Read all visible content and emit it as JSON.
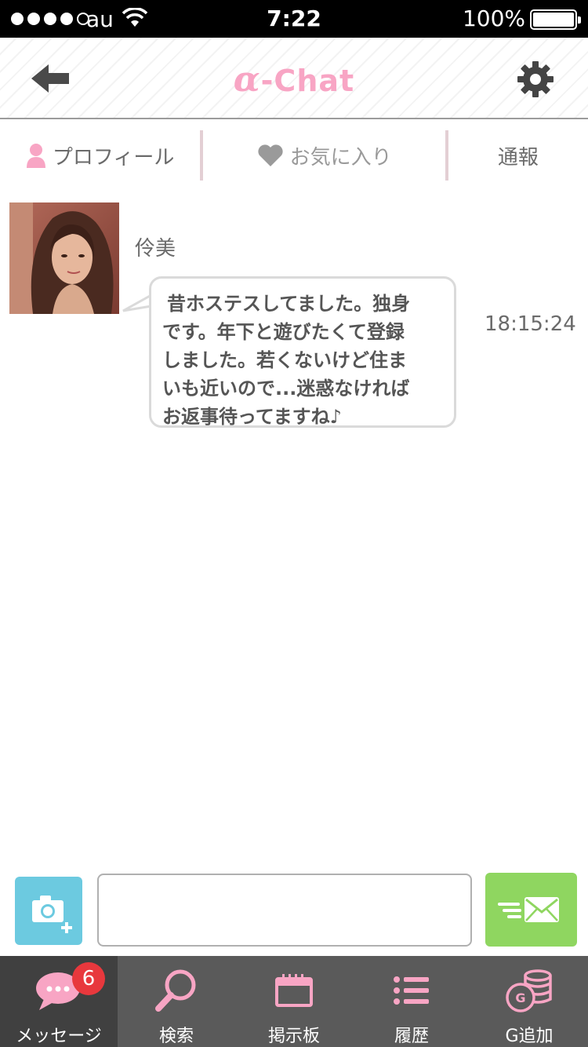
{
  "status_bar": {
    "carrier": "au",
    "time": "7:22",
    "battery_percent": "100%",
    "signal_bars": 4
  },
  "header": {
    "title_alpha": "α",
    "title_rest": "-Chat",
    "back_icon": "arrow-left-icon",
    "settings_icon": "gear-icon"
  },
  "tabs": [
    {
      "label": "プロフィール",
      "icon": "person-icon"
    },
    {
      "label": "お気に入り",
      "icon": "heart-icon"
    },
    {
      "label": "通報"
    }
  ],
  "message": {
    "sender": "伶美",
    "text_lines": [
      "昔ホステスしてました。独身",
      "です。年下と遊びたくて登録",
      "しました。若くないけど住ま",
      "いも近いので...迷惑なければ",
      "お返事待ってますね♪"
    ],
    "time": "18:15:24"
  },
  "input": {
    "value": "",
    "camera_icon": "camera-plus-icon",
    "send_icon": "envelope-send-icon"
  },
  "nav": [
    {
      "label": "メッセージ",
      "icon": "chat-bubble-icon",
      "badge": "6",
      "active": true
    },
    {
      "label": "検索",
      "icon": "magnifier-icon"
    },
    {
      "label": "掲示板",
      "icon": "board-icon"
    },
    {
      "label": "履歴",
      "icon": "list-icon"
    },
    {
      "label": "G追加",
      "icon": "coins-icon"
    }
  ],
  "colors": {
    "accent_pink": "#f8a5c4",
    "send_green": "#8fd660",
    "camera_blue": "#6ccae0",
    "nav_bg": "#5a5a5a",
    "badge_red": "#e8383d"
  }
}
